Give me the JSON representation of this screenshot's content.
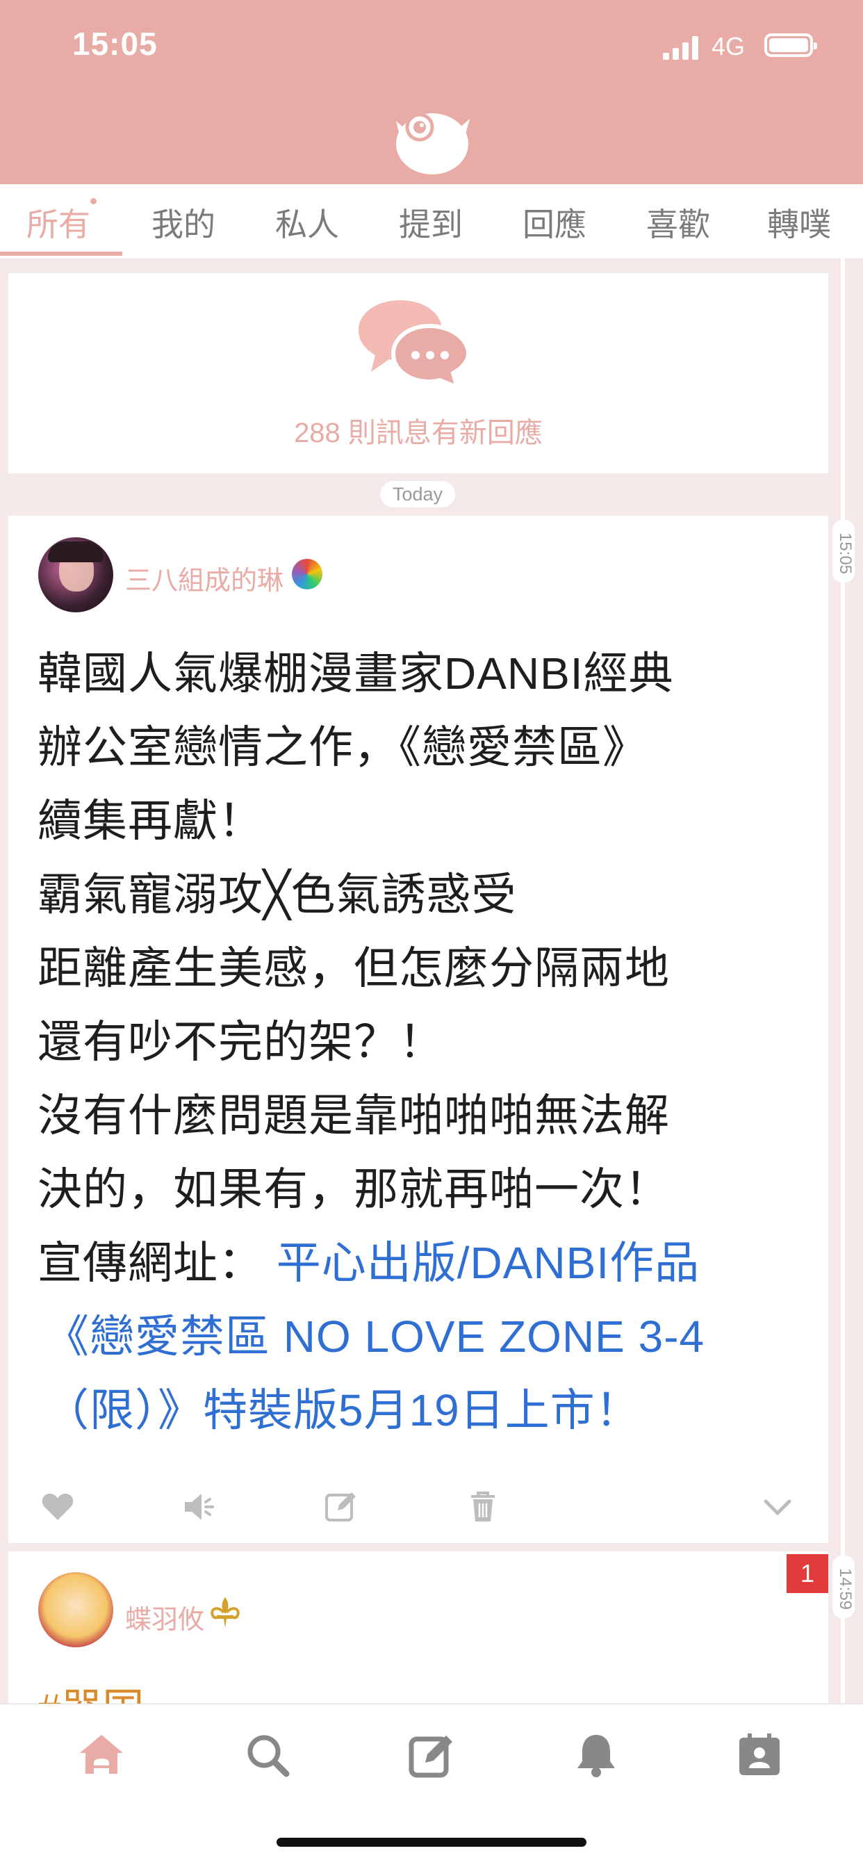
{
  "status_bar": {
    "time": "15:05",
    "network": "4G"
  },
  "tabs": [
    {
      "label": "所有",
      "active": true
    },
    {
      "label": "我的"
    },
    {
      "label": "私人"
    },
    {
      "label": "提到"
    },
    {
      "label": "回應"
    },
    {
      "label": "喜歡"
    },
    {
      "label": "轉噗"
    }
  ],
  "new_replies": {
    "text": "288 則訊息有新回應",
    "icon": "chat-bubbles-icon"
  },
  "date_divider": "Today",
  "posts": [
    {
      "timestamp": "15:05",
      "author": "三八組成的琳",
      "author_emoji": "lollipop-icon",
      "lines": [
        "韓國人氣爆棚漫畫家DANBI經典",
        "辦公室戀情之作，《戀愛禁區》",
        "續集再獻！",
        "霸氣寵溺攻╳色氣誘惑受",
        "距離產生美感，但怎麼分隔兩地",
        "還有吵不完的架？！",
        "沒有什麼問題是靠啪啪啪無法解",
        "決的，如果有，那就再啪一次！"
      ],
      "link_prefix": "宣傳網址：",
      "link_lines": [
        "平心出版/DANBI作品",
        "《戀愛禁區 NO LOVE ZONE 3-4",
        "（限）》特裝版5月19日上市！"
      ],
      "actions": [
        "heart-icon",
        "mute-icon",
        "edit-icon",
        "trash-icon",
        "chevron-down-icon"
      ]
    },
    {
      "timestamp": "14:59",
      "author": "蝶羽攸",
      "author_emoji": "fleur-de-lis-icon",
      "unread_badge": "1",
      "first_line": "#器国"
    }
  ],
  "bottom_nav": [
    "home-icon",
    "search-icon",
    "compose-icon",
    "bell-icon",
    "profile-card-icon"
  ],
  "colors": {
    "accent": "#e8aba6",
    "link": "#2f6fd3",
    "badge": "#e03a3a",
    "hashtag": "#d98b2b"
  }
}
